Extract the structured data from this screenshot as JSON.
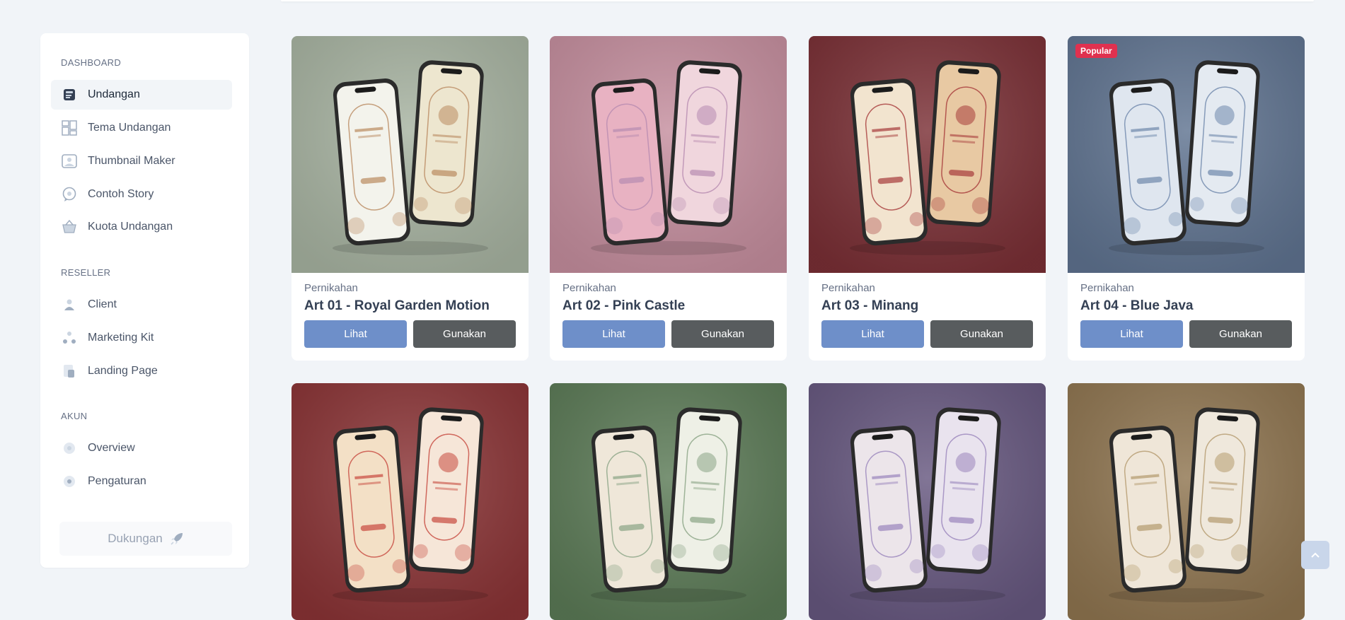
{
  "sidebar": {
    "sections": [
      {
        "label": "DASHBOARD",
        "items": [
          {
            "label": "Undangan",
            "icon": "invitation-icon"
          },
          {
            "label": "Tema Undangan",
            "icon": "grid-icon"
          },
          {
            "label": "Thumbnail Maker",
            "icon": "image-icon"
          },
          {
            "label": "Contoh Story",
            "icon": "chat-bubble-icon"
          },
          {
            "label": "Kuota Undangan",
            "icon": "basket-icon"
          }
        ]
      },
      {
        "label": "RESELLER",
        "items": [
          {
            "label": "Client",
            "icon": "user-icon"
          },
          {
            "label": "Marketing Kit",
            "icon": "nodes-icon"
          },
          {
            "label": "Landing Page",
            "icon": "page-icon"
          }
        ]
      },
      {
        "label": "AKUN",
        "items": [
          {
            "label": "Overview",
            "icon": "overview-icon"
          },
          {
            "label": "Pengaturan",
            "icon": "settings-icon"
          }
        ]
      }
    ],
    "support_label": "Dukungan",
    "support_icon": "rocket-icon"
  },
  "cards": [
    {
      "category": "Pernikahan",
      "title": "Art 01 - Royal Garden Motion",
      "view": "Lihat",
      "use": "Gunakan",
      "badge": "",
      "bg": "#a7b3a1",
      "screen_a": "#f3f3ec",
      "screen_b": "#ede6cf",
      "accent": "#b98a60"
    },
    {
      "category": "Pernikahan",
      "title": "Art 02 - Pink Castle",
      "view": "Lihat",
      "use": "Gunakan",
      "badge": "",
      "bg": "#c58e9e",
      "screen_a": "#e8b2c2",
      "screen_b": "#f0d6dd",
      "accent": "#b78bb0"
    },
    {
      "category": "Pernikahan",
      "title": "Art 03 - Minang",
      "view": "Lihat",
      "use": "Gunakan",
      "badge": "",
      "bg": "#7a2f35",
      "screen_a": "#f2e4cf",
      "screen_b": "#e8c9a3",
      "accent": "#a63a3a"
    },
    {
      "category": "Pernikahan",
      "title": "Art 04 - Blue Java",
      "view": "Lihat",
      "use": "Gunakan",
      "badge": "Popular",
      "bg": "#5f7390",
      "screen_a": "#dfe6ef",
      "screen_b": "#e4eaf1",
      "accent": "#6e87ab"
    },
    {
      "category": "",
      "title": "",
      "view": "",
      "use": "",
      "badge": "",
      "bg": "#8a3335",
      "screen_a": "#f3e0c6",
      "screen_b": "#f6e6d8",
      "accent": "#c7493e"
    },
    {
      "category": "",
      "title": "",
      "view": "",
      "use": "",
      "badge": "",
      "bg": "#5b7a56",
      "screen_a": "#efe7d9",
      "screen_b": "#eef0e6",
      "accent": "#8aa485"
    },
    {
      "category": "",
      "title": "",
      "view": "",
      "use": "",
      "badge": "",
      "bg": "#66577f",
      "screen_a": "#ece5ea",
      "screen_b": "#e9e3ee",
      "accent": "#9a85bc"
    },
    {
      "category": "",
      "title": "",
      "view": "",
      "use": "",
      "badge": "",
      "bg": "#8f7550",
      "screen_a": "#efe6d8",
      "screen_b": "#efe8dc",
      "accent": "#b49a6e"
    }
  ]
}
